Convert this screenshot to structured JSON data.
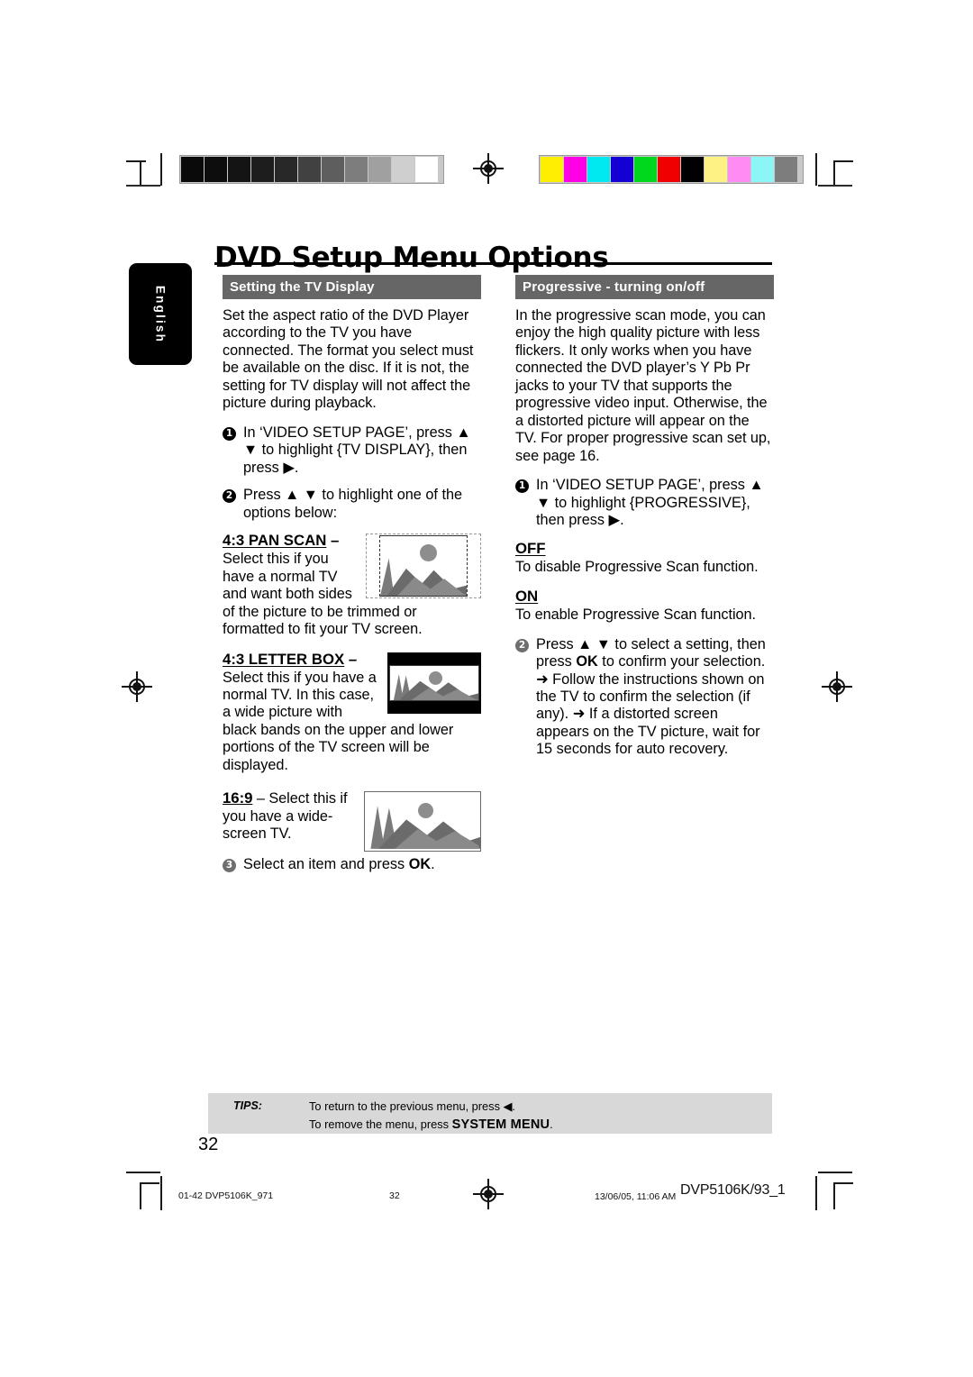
{
  "document": {
    "title": "DVD Setup Menu Options",
    "language_tab": "English",
    "page_number": "32"
  },
  "left_column": {
    "section_heading": "Setting the TV Display",
    "intro": "Set the aspect ratio of the DVD Player according to the TV you have connected. The format you select must be available on the disc.  If it is not, the setting for TV display will not affect the picture during playback.",
    "steps": [
      {
        "num": "1",
        "text": "In ‘VIDEO SETUP PAGE’, press ▲ ▼ to highlight {TV DISPLAY}, then press ▶."
      },
      {
        "num": "2",
        "text": "Press ▲ ▼ to highlight one of the options below:"
      }
    ],
    "options": [
      {
        "title": "4:3 PAN SCAN",
        "dash": " –",
        "text": "Select this if you have a normal TV and want both sides of the picture to be trimmed or formatted to fit your TV screen.",
        "image_name": "pan-scan-illustration"
      },
      {
        "title": "4:3 LETTER BOX",
        "dash": " –",
        "text": "Select this if you have a normal TV. In this case, a wide picture with black bands on the upper and lower portions of the TV screen will be displayed.",
        "image_name": "letter-box-illustration"
      },
      {
        "title": "16:9",
        "dash": " – ",
        "text": "Select this if you have a wide-screen TV.",
        "image_name": "widescreen-illustration"
      }
    ],
    "final_step": {
      "num": "3",
      "text_before": "Select an item and press ",
      "bold": "OK",
      "text_after": "."
    }
  },
  "right_column": {
    "section_heading": "Progressive - turning on/off",
    "intro": "In the progressive scan mode, you can enjoy the high quality picture with less flickers.  It only works when you have connected the DVD player’s Y Pb Pr jacks to your TV that supports the progressive video input.  Otherwise, the a distorted picture will appear on the TV.  For proper progressive scan set up, see page 16.",
    "step1": {
      "num": "1",
      "text": "In ‘VIDEO SETUP PAGE’, press ▲ ▼ to highlight {PROGRESSIVE}, then press ▶."
    },
    "settings": [
      {
        "title": "OFF",
        "text": "To disable Progressive Scan function."
      },
      {
        "title": "ON",
        "text": "To enable Progressive Scan function."
      }
    ],
    "step2": {
      "num": "2",
      "line1_a": "Press ▲ ▼ to select a setting, then press ",
      "line1_bold": "OK",
      "line1_b": " to confirm your selection.",
      "bullet1": "➜ Follow the instructions shown on the TV to confirm the selection (if any).",
      "bullet2": "➜ If a distorted screen appears on the TV picture, wait for 15 seconds for auto recovery."
    }
  },
  "tips": {
    "label": "TIPS:",
    "line1": "To return to the previous menu, press ◀.",
    "line2_a": "To remove the menu, press ",
    "line2_bold": "SYSTEM MENU",
    "line2_b": "."
  },
  "production_footer": {
    "file_left": "01-42 DVP5106K_971",
    "page": "32",
    "timestamp": "13/06/05, 11:06 AM",
    "model_code": "DVP5106K/93_1"
  },
  "calibration": {
    "grayscale_swatches": [
      "#0a0a0a",
      "#0d0d0d",
      "#141414",
      "#1d1d1d",
      "#282828",
      "#414141",
      "#5e5e5e",
      "#7d7d7d",
      "#a0a0a0",
      "#cfcfcf",
      "#ffffff"
    ],
    "color_swatches": [
      "#ffee00",
      "#ff00e6",
      "#00e8f0",
      "#1400d2",
      "#00d81e",
      "#f00000",
      "#000000",
      "#fff285",
      "#ff8cf0",
      "#8cf5f5",
      "#7d7d7d"
    ]
  }
}
